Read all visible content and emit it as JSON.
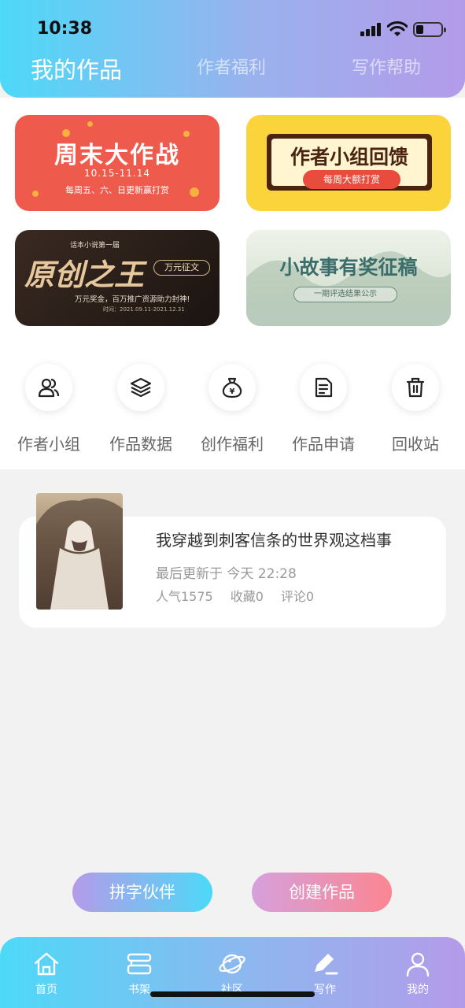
{
  "status_bar": {
    "time": "10:38"
  },
  "header": {
    "tabs": [
      {
        "label": "我的作品",
        "active": true
      },
      {
        "label": "作者福利",
        "active": false
      },
      {
        "label": "写作帮助",
        "active": false
      }
    ]
  },
  "banners": [
    {
      "title": "周末大作战",
      "date": "10.15-11.14",
      "subtitle": "每周五、六、日更新赢打赏"
    },
    {
      "title": "作者小组回馈",
      "subtitle": "每周大额打赏"
    },
    {
      "kicker": "话本小说第一届",
      "title": "原创之王",
      "tag": "万元征文",
      "subtitle": "万元奖金，百万推广资源助力封神!",
      "date": "时间：2021.09.11-2021.12.31"
    },
    {
      "title": "小故事有奖征稿",
      "subtitle": "一期评选结果公示"
    }
  ],
  "actions": [
    {
      "label": "作者小组",
      "icon": "author-group-icon"
    },
    {
      "label": "作品数据",
      "icon": "layers-icon"
    },
    {
      "label": "创作福利",
      "icon": "money-bag-icon"
    },
    {
      "label": "作品申请",
      "icon": "document-icon"
    },
    {
      "label": "回收站",
      "icon": "trash-icon"
    }
  ],
  "works": [
    {
      "title": "我穿越到刺客信条的世界观这档事",
      "updated": "最后更新于 今天 22:28",
      "popularity": "人气1575",
      "favorites": "收藏0",
      "comments": "评论0"
    }
  ],
  "buttons": {
    "partner": "拼字伙伴",
    "create": "创建作品"
  },
  "bottom_nav": [
    {
      "label": "首页",
      "icon": "home-icon"
    },
    {
      "label": "书架",
      "icon": "bookshelf-icon"
    },
    {
      "label": "社区",
      "icon": "planet-icon"
    },
    {
      "label": "写作",
      "icon": "pen-icon",
      "active": true
    },
    {
      "label": "我的",
      "icon": "profile-icon"
    }
  ],
  "colors": {
    "gradient_start": "#4dd9f8",
    "gradient_end": "#b49be9",
    "create_end": "#fb8692"
  }
}
